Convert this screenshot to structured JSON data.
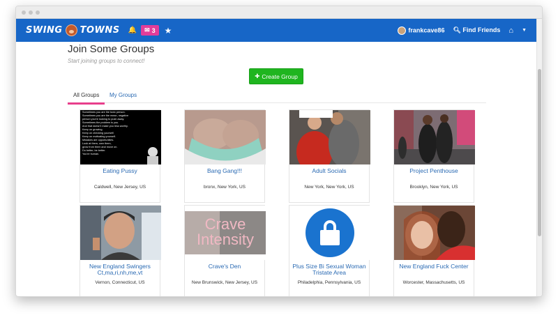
{
  "app": {
    "logo_left": "SWING",
    "logo_right": "TOWNS",
    "message_count": "3",
    "username": "frankcave86",
    "find_friends": "Find Friends"
  },
  "page": {
    "title": "Join Some Groups",
    "subtitle": "Start joining groups to connect!",
    "create_button": "Create Group"
  },
  "tabs": [
    {
      "label": "All Groups",
      "active": true
    },
    {
      "label": "My Groups",
      "active": false
    }
  ],
  "groups": [
    {
      "name": "Eating Pussy",
      "location": "Caldwell, New Jersey, US"
    },
    {
      "name": "Bang Gang!!!",
      "location": "bronx, New York, US"
    },
    {
      "name": "Adult Socials",
      "location": "New York, New York, US"
    },
    {
      "name": "Project Penthouse",
      "location": "Brooklyn, New York, US"
    },
    {
      "name": "New England Swingers Ct,ma,ri,nh,me,vt",
      "location": "Vernon, Connecticut, US"
    },
    {
      "name": "Crave's Den",
      "location": "New Brunswick, New Jersey, US"
    },
    {
      "name": "Plus Size Bi Sexual Woman Tristate Area",
      "location": "Philadelphia, Pennsylvania, US"
    },
    {
      "name": "New England Fuck Center",
      "location": "Worcester, Massachusetts, US"
    }
  ],
  "image_text": {
    "quote_lines": [
      "Sometimes you are the toxic person.",
      "Sometimes you are the mean, negative",
      "person you're looking to push away.",
      "Sometimes the problem is you.",
      "And that doesn't make you less worthy.",
      "Keep on growing.",
      "Keep on checking yourself.",
      "Keep on motivating yourself.",
      "Mistakes are opportunities.",
      "Look at them, own them,",
      "grow from them and move on.",
      "Do better, be better.",
      "You're human."
    ],
    "crave_line1": "Crave",
    "crave_line2": "Intensity"
  },
  "colors": {
    "navbar": "#1766c7",
    "accent_pink": "#e83e8c",
    "create_green": "#1fb51f",
    "link_blue": "#2a6ab3"
  },
  "icons": [
    "bell-icon",
    "envelope-icon",
    "star-icon",
    "search-icon",
    "home-icon",
    "caret-down-icon",
    "plus-icon",
    "lock-icon"
  ]
}
